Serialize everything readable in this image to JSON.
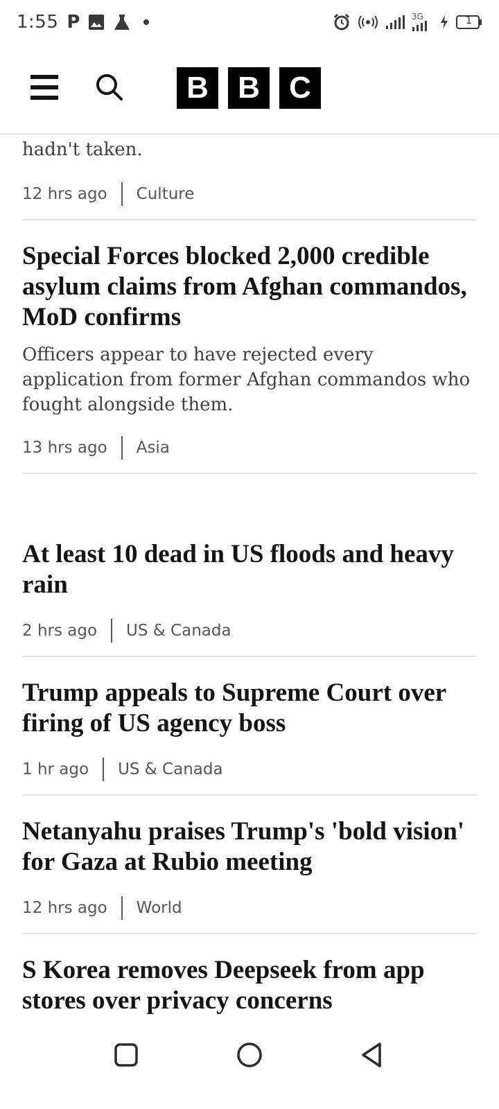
{
  "status_bar": {
    "time": "1:55",
    "left_icons": [
      "parking-icon",
      "image-icon",
      "flask-icon",
      "dot-icon"
    ],
    "right_icons": [
      "alarm-icon",
      "hotspot-icon",
      "signal-icon",
      "signal-4g-icon",
      "charging-icon",
      "battery-icon"
    ],
    "battery_level": "1",
    "network_label": "3G"
  },
  "header": {
    "logo_letters": [
      "B",
      "B",
      "C"
    ]
  },
  "partial_article": {
    "snippet_tail": "hadn't taken.",
    "time": "12 hrs ago",
    "section": "Culture"
  },
  "articles": [
    {
      "headline": "Special Forces blocked 2,000 credible asylum claims from Afghan commandos, MoD confirms",
      "summary": "Officers appear to have rejected every application from former Afghan commandos who fought alongside them.",
      "time": "13 hrs ago",
      "section": "Asia"
    },
    {
      "headline": "At least 10 dead in US floods and heavy rain",
      "time": "2 hrs ago",
      "section": "US & Canada"
    },
    {
      "headline": "Trump appeals to Supreme Court over firing of US agency boss",
      "time": "1 hr ago",
      "section": "US & Canada"
    },
    {
      "headline": "Netanyahu praises Trump's 'bold vision' for Gaza at Rubio meeting",
      "time": "12 hrs ago",
      "section": "World"
    },
    {
      "headline": "S Korea removes Deepseek from app stores over privacy concerns"
    }
  ],
  "nav_bar": {
    "buttons": [
      "recents-button",
      "home-button",
      "back-button"
    ]
  }
}
